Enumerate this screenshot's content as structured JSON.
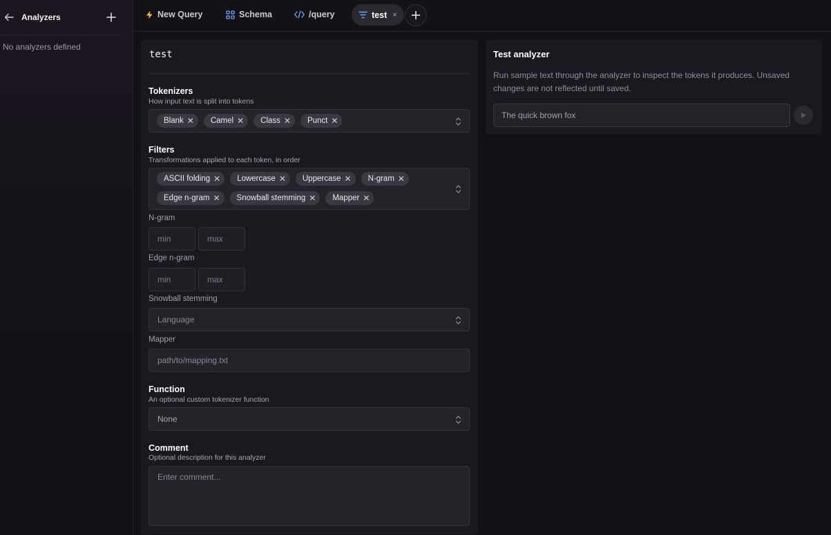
{
  "sidebar": {
    "title": "Analyzers",
    "empty_text": "No analyzers defined"
  },
  "tabs": [
    {
      "label": "New Query",
      "icon": "lightning-icon"
    },
    {
      "label": "Schema",
      "icon": "schema-icon"
    },
    {
      "label": "/query",
      "icon": "code-icon"
    },
    {
      "label": "test",
      "icon": "filter-icon",
      "active": true,
      "close": "×"
    }
  ],
  "analyzer": {
    "name": "test",
    "tokenizers": {
      "title": "Tokenizers",
      "subtitle": "How input text is split into tokens",
      "chips": [
        "Blank",
        "Camel",
        "Class",
        "Punct"
      ]
    },
    "filters": {
      "title": "Filters",
      "subtitle": "Transformations applied to each token, in order",
      "chips_row1": [
        "ASCII folding",
        "Lowercase",
        "Uppercase",
        "N-gram"
      ],
      "chips_row2": [
        "Edge n-gram",
        "Snowball stemming",
        "Mapper"
      ]
    },
    "ngram": {
      "label": "N-gram",
      "min_placeholder": "min",
      "max_placeholder": "max"
    },
    "edge_ngram": {
      "label": "Edge n-gram",
      "min_placeholder": "min",
      "max_placeholder": "max"
    },
    "snowball": {
      "label": "Snowball stemming",
      "placeholder": "Language"
    },
    "mapper": {
      "label": "Mapper",
      "placeholder": "path/to/mapping.txt"
    },
    "function": {
      "title": "Function",
      "subtitle": "An optional custom tokenizer function",
      "value": "None"
    },
    "comment": {
      "title": "Comment",
      "subtitle": "Optional description for this analyzer",
      "placeholder": "Enter comment..."
    }
  },
  "test_panel": {
    "title": "Test analyzer",
    "description": "Run sample text through the analyzer to inspect the tokens it produces. Unsaved changes are not reflected until saved.",
    "input_placeholder": "The quick brown fox"
  },
  "colors": {
    "accent_yellow": "#f5c542",
    "accent_blue": "#6aa8ff",
    "background": "#121116",
    "panel": "#1a191f"
  }
}
